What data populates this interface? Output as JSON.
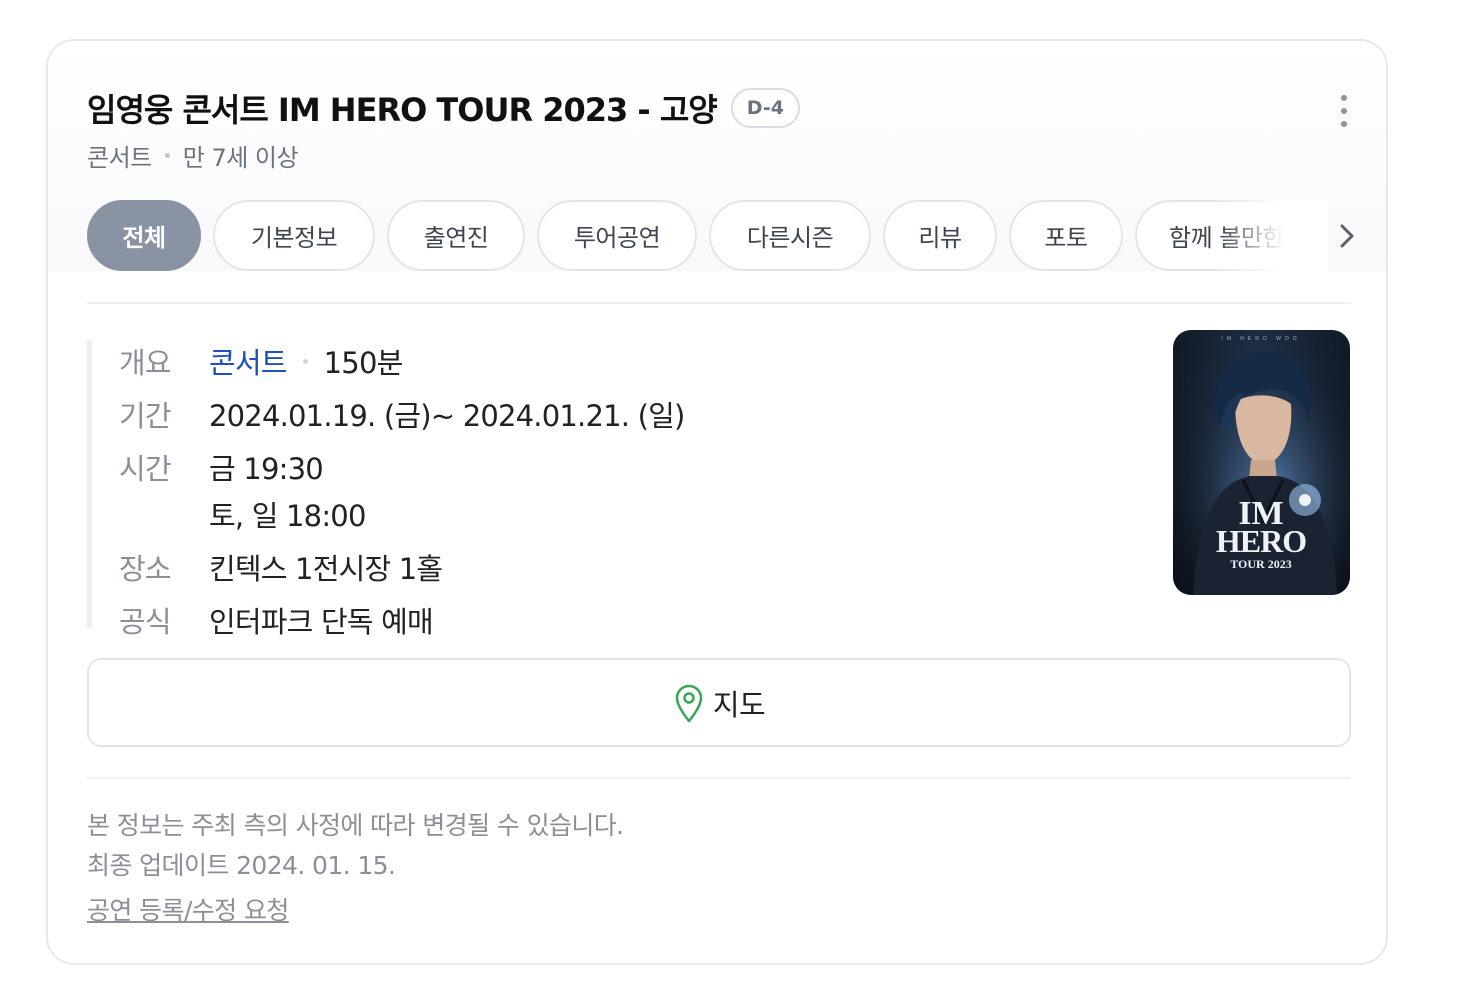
{
  "event": {
    "title": "임영웅 콘서트 IM HERO TOUR 2023 - 고양",
    "dday": "D-4",
    "category": "콘서트",
    "age_limit": "만 7세 이상"
  },
  "tabs": [
    {
      "label": "전체",
      "active": true
    },
    {
      "label": "기본정보",
      "active": false
    },
    {
      "label": "출연진",
      "active": false
    },
    {
      "label": "투어공연",
      "active": false
    },
    {
      "label": "다른시즌",
      "active": false
    },
    {
      "label": "리뷰",
      "active": false
    },
    {
      "label": "포토",
      "active": false
    },
    {
      "label": "함께 볼만한 공",
      "active": false
    }
  ],
  "details": {
    "overview_label": "개요",
    "overview_genre": "콘서트",
    "overview_duration": "150분",
    "period_label": "기간",
    "period_value": "2024.01.19. (금)~ 2024.01.21. (일)",
    "time_label": "시간",
    "time_line1": "금 19:30",
    "time_line2": "토, 일 18:00",
    "venue_label": "장소",
    "venue_value": "킨텍스 1전시장 1홀",
    "official_label": "공식",
    "official_value": "인터파크 단독 예매"
  },
  "poster": {
    "top_text": "IM HERO WOO",
    "logo_line1": "IM",
    "logo_line2": "HERO",
    "logo_line3": "TOUR 2023"
  },
  "map_button": {
    "label": "지도",
    "icon": "map-pin-icon"
  },
  "footer": {
    "notice": "본 정보는 주최 측의 사정에 따라 변경될 수 있습니다.",
    "updated": "최종 업데이트 2024. 01. 15.",
    "edit_link": "공연 등록/수정 요청"
  },
  "colors": {
    "active_tab": "#8a93a3",
    "link": "#1f4fbf",
    "map_pin": "#3aa65a"
  }
}
